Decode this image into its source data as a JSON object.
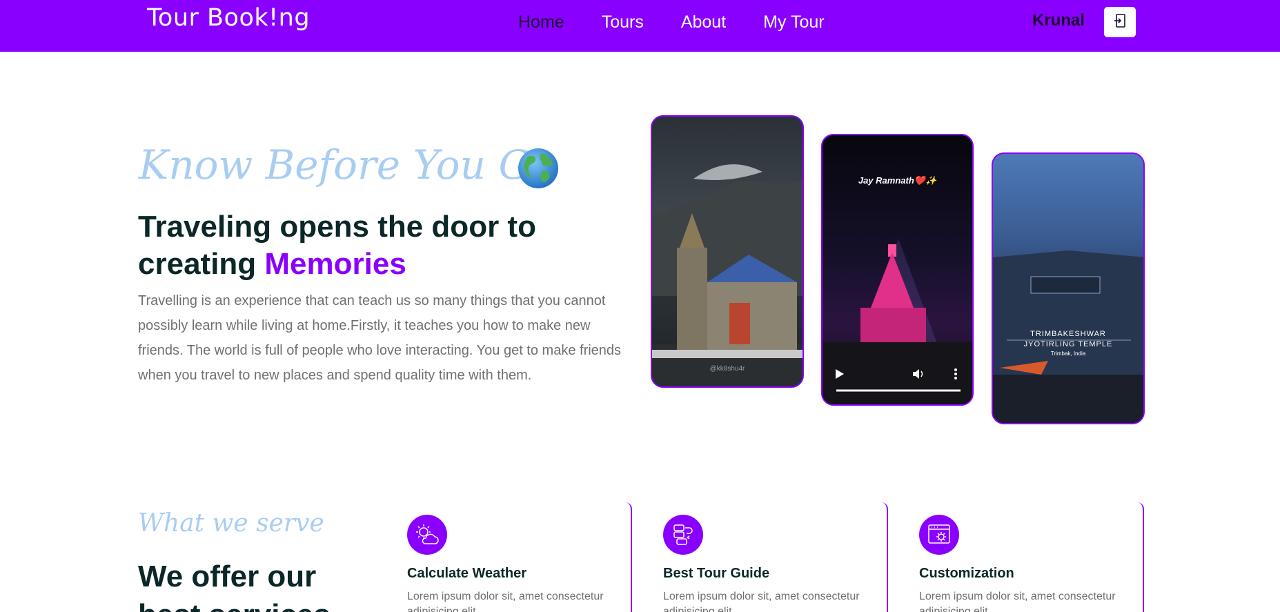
{
  "header": {
    "logo": "Tour Book!ng",
    "nav": [
      "Home",
      "Tours",
      "About",
      "My Tour"
    ],
    "active_nav": "Home",
    "username": "Krunal",
    "logout_icon": "logout-icon"
  },
  "hero": {
    "script_subtitle": "Know Before You Go",
    "globe_icon": "globe-icon",
    "title_part1": "Traveling opens the door to creating ",
    "title_accent": "Memories",
    "description": "Travelling is an experience that can teach us so many things that you cannot possibly learn while living at home.Firstly, it teaches you how to make new friends. The world is full of people who love interacting. You get to make friends when you travel to new places and spend quality time with them.",
    "photos": [
      {
        "caption": "@kk8shu4r"
      },
      {
        "caption": "Jay Ramnath❤️✨"
      },
      {
        "caption_line1": "TRIMBAKESHWAR",
        "caption_line2": "JYOTIRLING TEMPLE",
        "caption_line3": "Trimbak, India"
      }
    ]
  },
  "services": {
    "script_subtitle": "What we serve",
    "title": "We offer our best services",
    "cards": [
      {
        "icon": "weather-icon",
        "title": "Calculate Weather",
        "desc": "Lorem ipsum dolor sit, amet consectetur adipisicing elit."
      },
      {
        "icon": "guide-icon",
        "title": "Best Tour Guide",
        "desc": "Lorem ipsum dolor sit, amet consectetur adipisicing elit."
      },
      {
        "icon": "customization-icon",
        "title": "Customization",
        "desc": "Lorem ipsum dolor sit, amet consectetur adipisicing elit."
      }
    ]
  },
  "colors": {
    "brand": "#8a00ff",
    "script": "#a9cdf2",
    "heading": "#0b2727",
    "text": "#707070"
  }
}
